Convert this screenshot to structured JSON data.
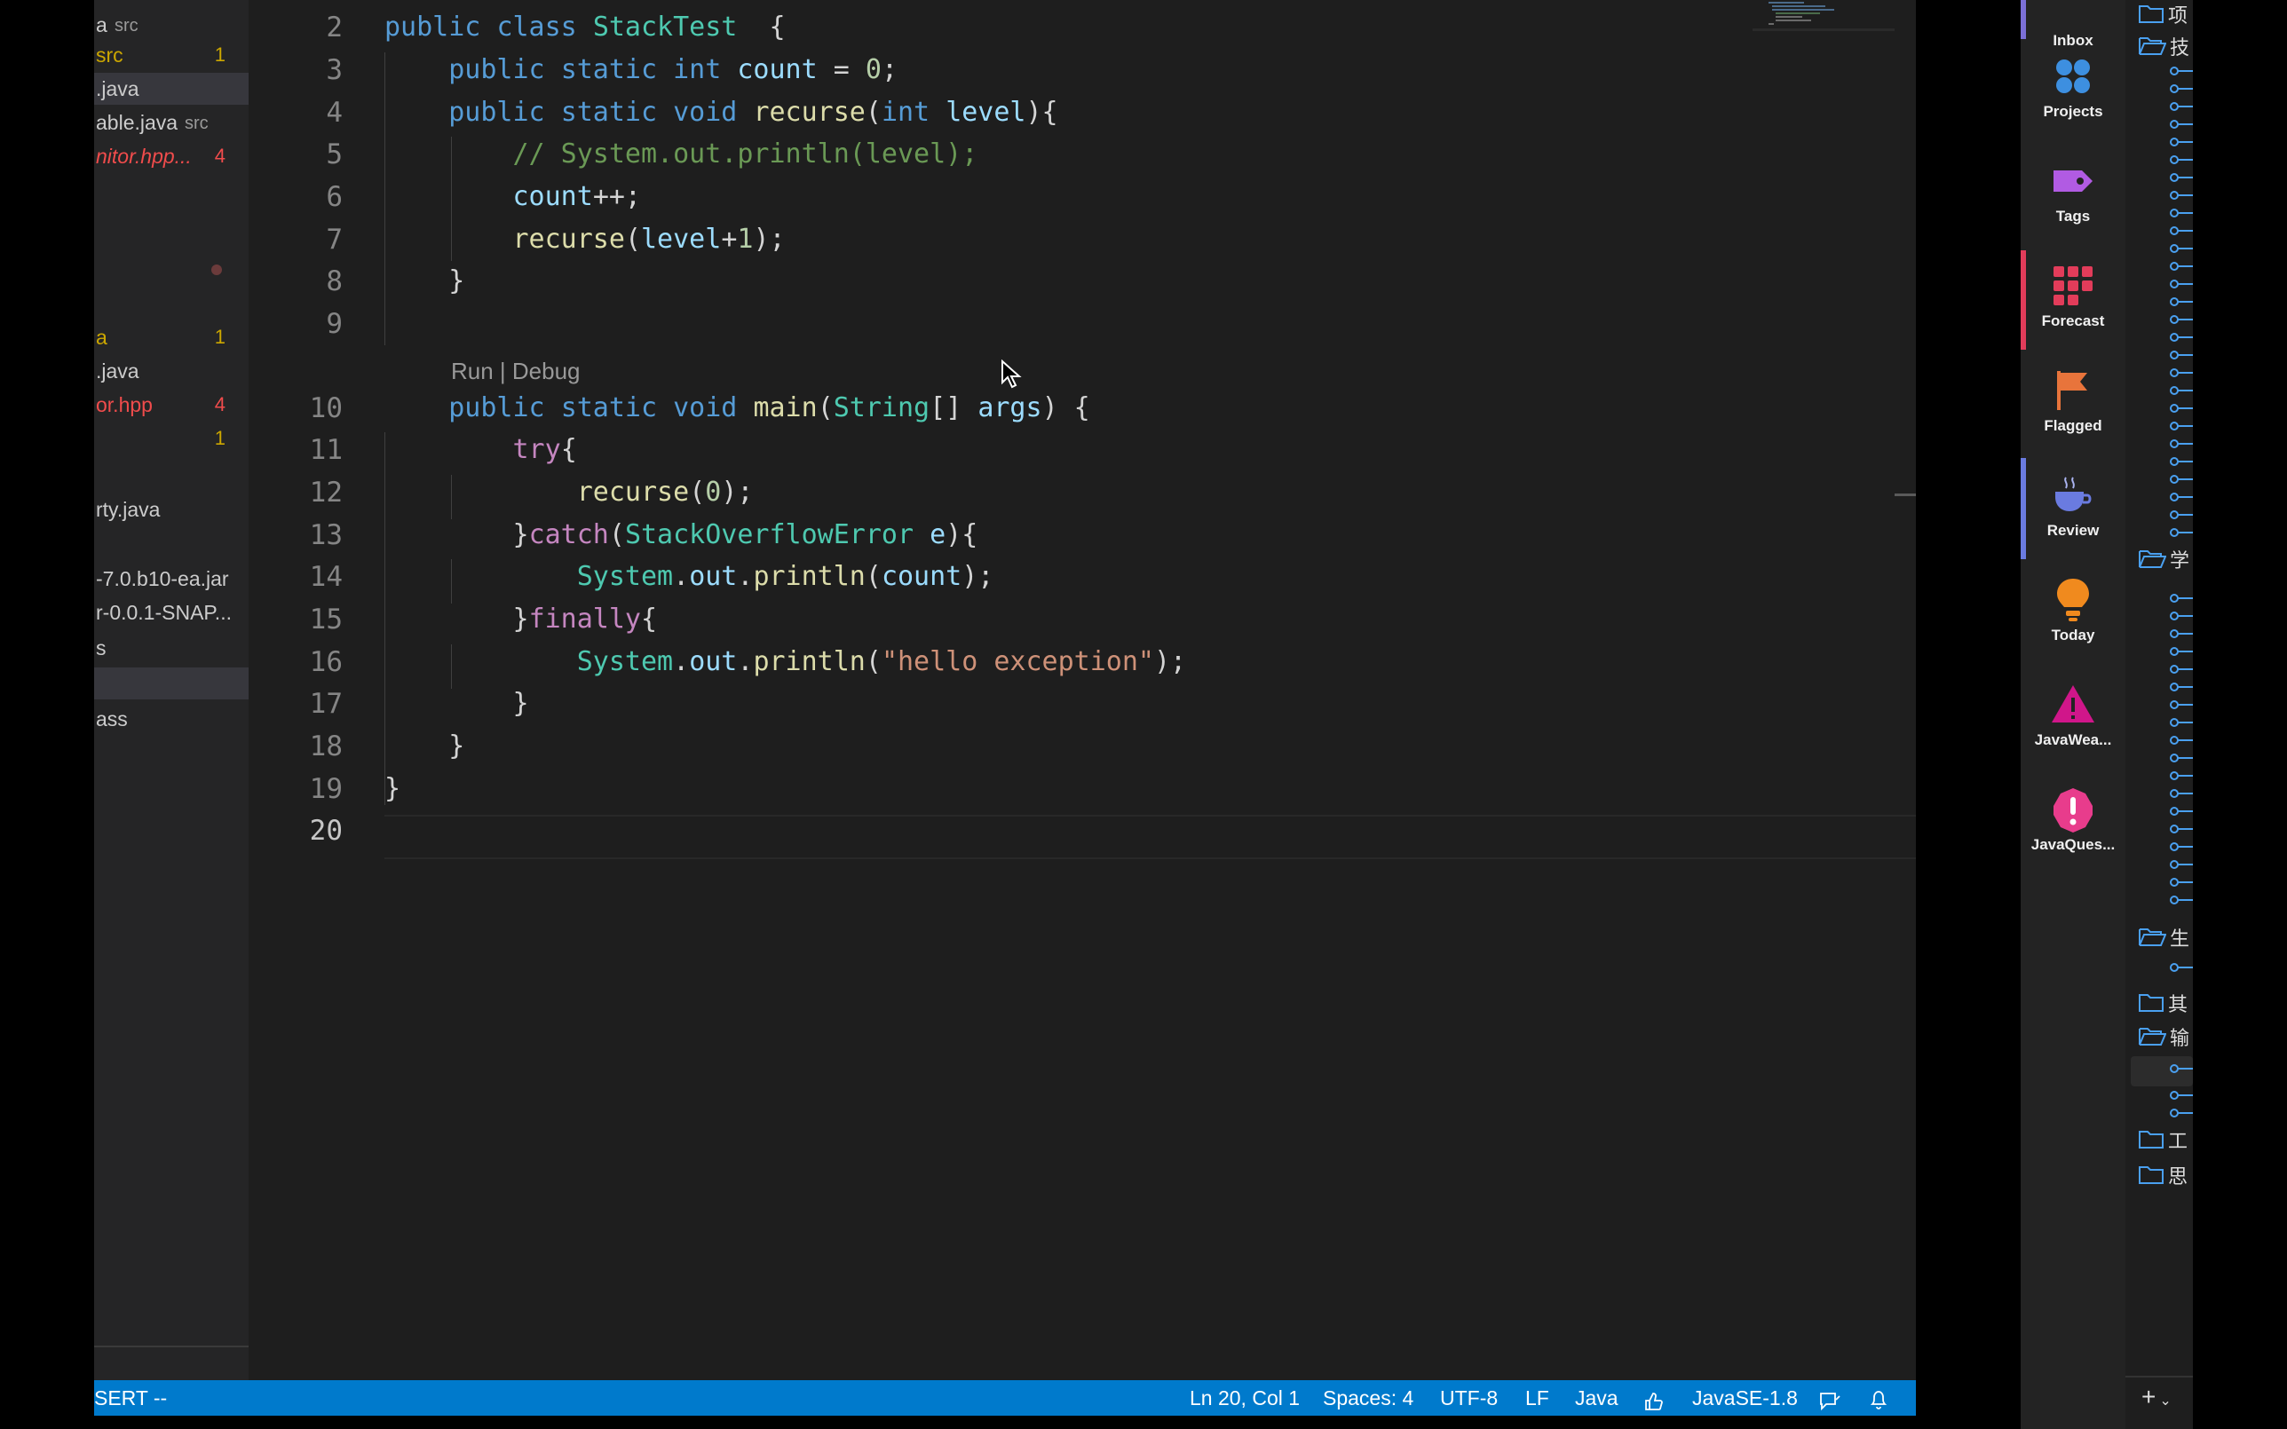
{
  "sidebar": {
    "items": [
      {
        "name": "a",
        "sub": "src",
        "badge": "",
        "kind": "normal"
      },
      {
        "name": "src",
        "sub": "",
        "badge": "1",
        "kind": "warn"
      },
      {
        "name": ".java",
        "sub": "",
        "badge": "",
        "kind": "normal",
        "selected": true
      },
      {
        "name": "able.java",
        "sub": "src",
        "badge": "",
        "kind": "normal"
      },
      {
        "name": "nitor.hpp...",
        "sub": "",
        "badge": "4",
        "kind": "err"
      },
      {
        "name": "",
        "sub": "",
        "badge": "",
        "kind": "normal"
      },
      {
        "name": "",
        "sub": "",
        "badge": "",
        "kind": "normal"
      },
      {
        "name": "",
        "sub": "",
        "badge": "",
        "kind": "dot"
      },
      {
        "name": "",
        "sub": "",
        "badge": "",
        "kind": "normal"
      },
      {
        "name": "a",
        "sub": "",
        "badge": "1",
        "kind": "warn"
      },
      {
        "name": ".java",
        "sub": "",
        "badge": "",
        "kind": "normal"
      },
      {
        "name": "or.hpp",
        "sub": "",
        "badge": "4",
        "kind": "errplain"
      },
      {
        "name": "",
        "sub": "",
        "badge": "1",
        "kind": "warn"
      },
      {
        "name": "",
        "sub": "",
        "badge": "",
        "kind": "normal"
      },
      {
        "name": "rty.java",
        "sub": "",
        "badge": "",
        "kind": "normal"
      },
      {
        "name": "",
        "sub": "",
        "badge": "",
        "kind": "normal"
      },
      {
        "name": "-7.0.b10-ea.jar",
        "sub": "",
        "badge": "",
        "kind": "normal"
      },
      {
        "name": "r-0.0.1-SNAP...",
        "sub": "",
        "badge": "",
        "kind": "normal"
      },
      {
        "name": "s",
        "sub": "",
        "badge": "",
        "kind": "normal"
      },
      {
        "name": "",
        "sub": "",
        "badge": "",
        "kind": "normal",
        "selected": true
      },
      {
        "name": "ass",
        "sub": "",
        "badge": "",
        "kind": "normal"
      }
    ]
  },
  "editor": {
    "codelens": "Run | Debug",
    "lines": [
      {
        "n": "2",
        "tokens": [
          [
            "kw",
            "public "
          ],
          [
            "kw",
            "class "
          ],
          [
            "ty",
            "StackTest"
          ],
          [
            "",
            "  {"
          ]
        ]
      },
      {
        "n": "3",
        "tokens": [
          [
            "",
            "    "
          ],
          [
            "kw",
            "public "
          ],
          [
            "kw",
            "static "
          ],
          [
            "kw",
            "int "
          ],
          [
            "va",
            "count"
          ],
          [
            "",
            " = "
          ],
          [
            "nu",
            "0"
          ],
          [
            "",
            ";"
          ]
        ]
      },
      {
        "n": "4",
        "tokens": [
          [
            "",
            "    "
          ],
          [
            "kw",
            "public "
          ],
          [
            "kw",
            "static "
          ],
          [
            "kw",
            "void "
          ],
          [
            "fn",
            "recurse"
          ],
          [
            "",
            "("
          ],
          [
            "kw",
            "int "
          ],
          [
            "va",
            "level"
          ],
          [
            "",
            "){"
          ]
        ]
      },
      {
        "n": "5",
        "tokens": [
          [
            "",
            "        "
          ],
          [
            "cm",
            "// System.out.println(level);"
          ]
        ]
      },
      {
        "n": "6",
        "tokens": [
          [
            "",
            "        "
          ],
          [
            "va",
            "count"
          ],
          [
            "",
            "++;"
          ]
        ]
      },
      {
        "n": "7",
        "tokens": [
          [
            "",
            "        "
          ],
          [
            "fn",
            "recurse"
          ],
          [
            "",
            "("
          ],
          [
            "va",
            "level"
          ],
          [
            "",
            "+"
          ],
          [
            "nu",
            "1"
          ],
          [
            "",
            ");"
          ]
        ]
      },
      {
        "n": "8",
        "tokens": [
          [
            "",
            "    }"
          ]
        ]
      },
      {
        "n": "9",
        "tokens": [
          [
            "",
            ""
          ]
        ]
      },
      {
        "n": "10",
        "tokens": [
          [
            "",
            "    "
          ],
          [
            "kw",
            "public "
          ],
          [
            "kw",
            "static "
          ],
          [
            "kw",
            "void "
          ],
          [
            "fn",
            "main"
          ],
          [
            "",
            "("
          ],
          [
            "ty",
            "String"
          ],
          [
            "",
            "[] "
          ],
          [
            "va",
            "args"
          ],
          [
            "",
            ") {"
          ]
        ]
      },
      {
        "n": "11",
        "tokens": [
          [
            "",
            "        "
          ],
          [
            "kw2",
            "try"
          ],
          [
            "",
            "{"
          ]
        ]
      },
      {
        "n": "12",
        "tokens": [
          [
            "",
            "            "
          ],
          [
            "fn",
            "recurse"
          ],
          [
            "",
            "("
          ],
          [
            "nu",
            "0"
          ],
          [
            "",
            ");"
          ]
        ]
      },
      {
        "n": "13",
        "tokens": [
          [
            "",
            "        }"
          ],
          [
            "kw2",
            "catch"
          ],
          [
            "",
            "("
          ],
          [
            "ty",
            "StackOverflowError"
          ],
          [
            "",
            " "
          ],
          [
            "va",
            "e"
          ],
          [
            "",
            "){"
          ]
        ]
      },
      {
        "n": "14",
        "tokens": [
          [
            "",
            "            "
          ],
          [
            "ty",
            "System"
          ],
          [
            "",
            "."
          ],
          [
            "va",
            "out"
          ],
          [
            "",
            "."
          ],
          [
            "fn",
            "println"
          ],
          [
            "",
            "("
          ],
          [
            "va",
            "count"
          ],
          [
            "",
            ");"
          ]
        ]
      },
      {
        "n": "15",
        "tokens": [
          [
            "",
            "        }"
          ],
          [
            "kw2",
            "finally"
          ],
          [
            "",
            "{"
          ]
        ]
      },
      {
        "n": "16",
        "tokens": [
          [
            "",
            "            "
          ],
          [
            "ty",
            "System"
          ],
          [
            "",
            "."
          ],
          [
            "va",
            "out"
          ],
          [
            "",
            "."
          ],
          [
            "fn",
            "println"
          ],
          [
            "",
            "("
          ],
          [
            "st",
            "\"hello exception\""
          ],
          [
            "",
            ");"
          ]
        ]
      },
      {
        "n": "17",
        "tokens": [
          [
            "",
            "        }"
          ]
        ]
      },
      {
        "n": "18",
        "tokens": [
          [
            "",
            "    }"
          ]
        ]
      },
      {
        "n": "19",
        "tokens": [
          [
            "",
            "}"
          ]
        ]
      },
      {
        "n": "20",
        "tokens": [
          [
            "",
            ""
          ]
        ]
      }
    ]
  },
  "statusbar": {
    "mode": "SERT --",
    "position": "Ln 20, Col 1",
    "spaces": "Spaces: 4",
    "encoding": "UTF-8",
    "eol": "LF",
    "language": "Java",
    "runtime": "JavaSE-1.8"
  },
  "app_nav": {
    "items": [
      {
        "label": "Inbox",
        "icon": "inbox-icon",
        "color": "#7b6fd6"
      },
      {
        "label": "Projects",
        "icon": "projects-icon",
        "color": "#3d8fe0"
      },
      {
        "label": "Tags",
        "icon": "tag-icon",
        "color": "#b15be3"
      },
      {
        "label": "Forecast",
        "icon": "forecast-icon",
        "color": "#e23c5a"
      },
      {
        "label": "Flagged",
        "icon": "flag-icon",
        "color": "#e8743b"
      },
      {
        "label": "Review",
        "icon": "coffee-cup-icon",
        "color": "#6a7be0"
      },
      {
        "label": "Today",
        "icon": "lightbulb-icon",
        "color": "#f08a1e"
      },
      {
        "label": "JavaWea...",
        "icon": "warning-triangle-icon",
        "color": "#d0168a"
      },
      {
        "label": "JavaQues...",
        "icon": "alert-circle-icon",
        "color": "#e83c8c"
      }
    ]
  },
  "app_list": {
    "folders": [
      {
        "label": "项",
        "open": false
      },
      {
        "label": "技",
        "open": true
      },
      {
        "label": "学",
        "open": true
      },
      {
        "label": "生",
        "open": true
      },
      {
        "label": "其",
        "open": false
      },
      {
        "label": "输",
        "open": true
      },
      {
        "label": "工",
        "open": false
      },
      {
        "label": "思",
        "open": false
      }
    ],
    "add_label": "+"
  }
}
